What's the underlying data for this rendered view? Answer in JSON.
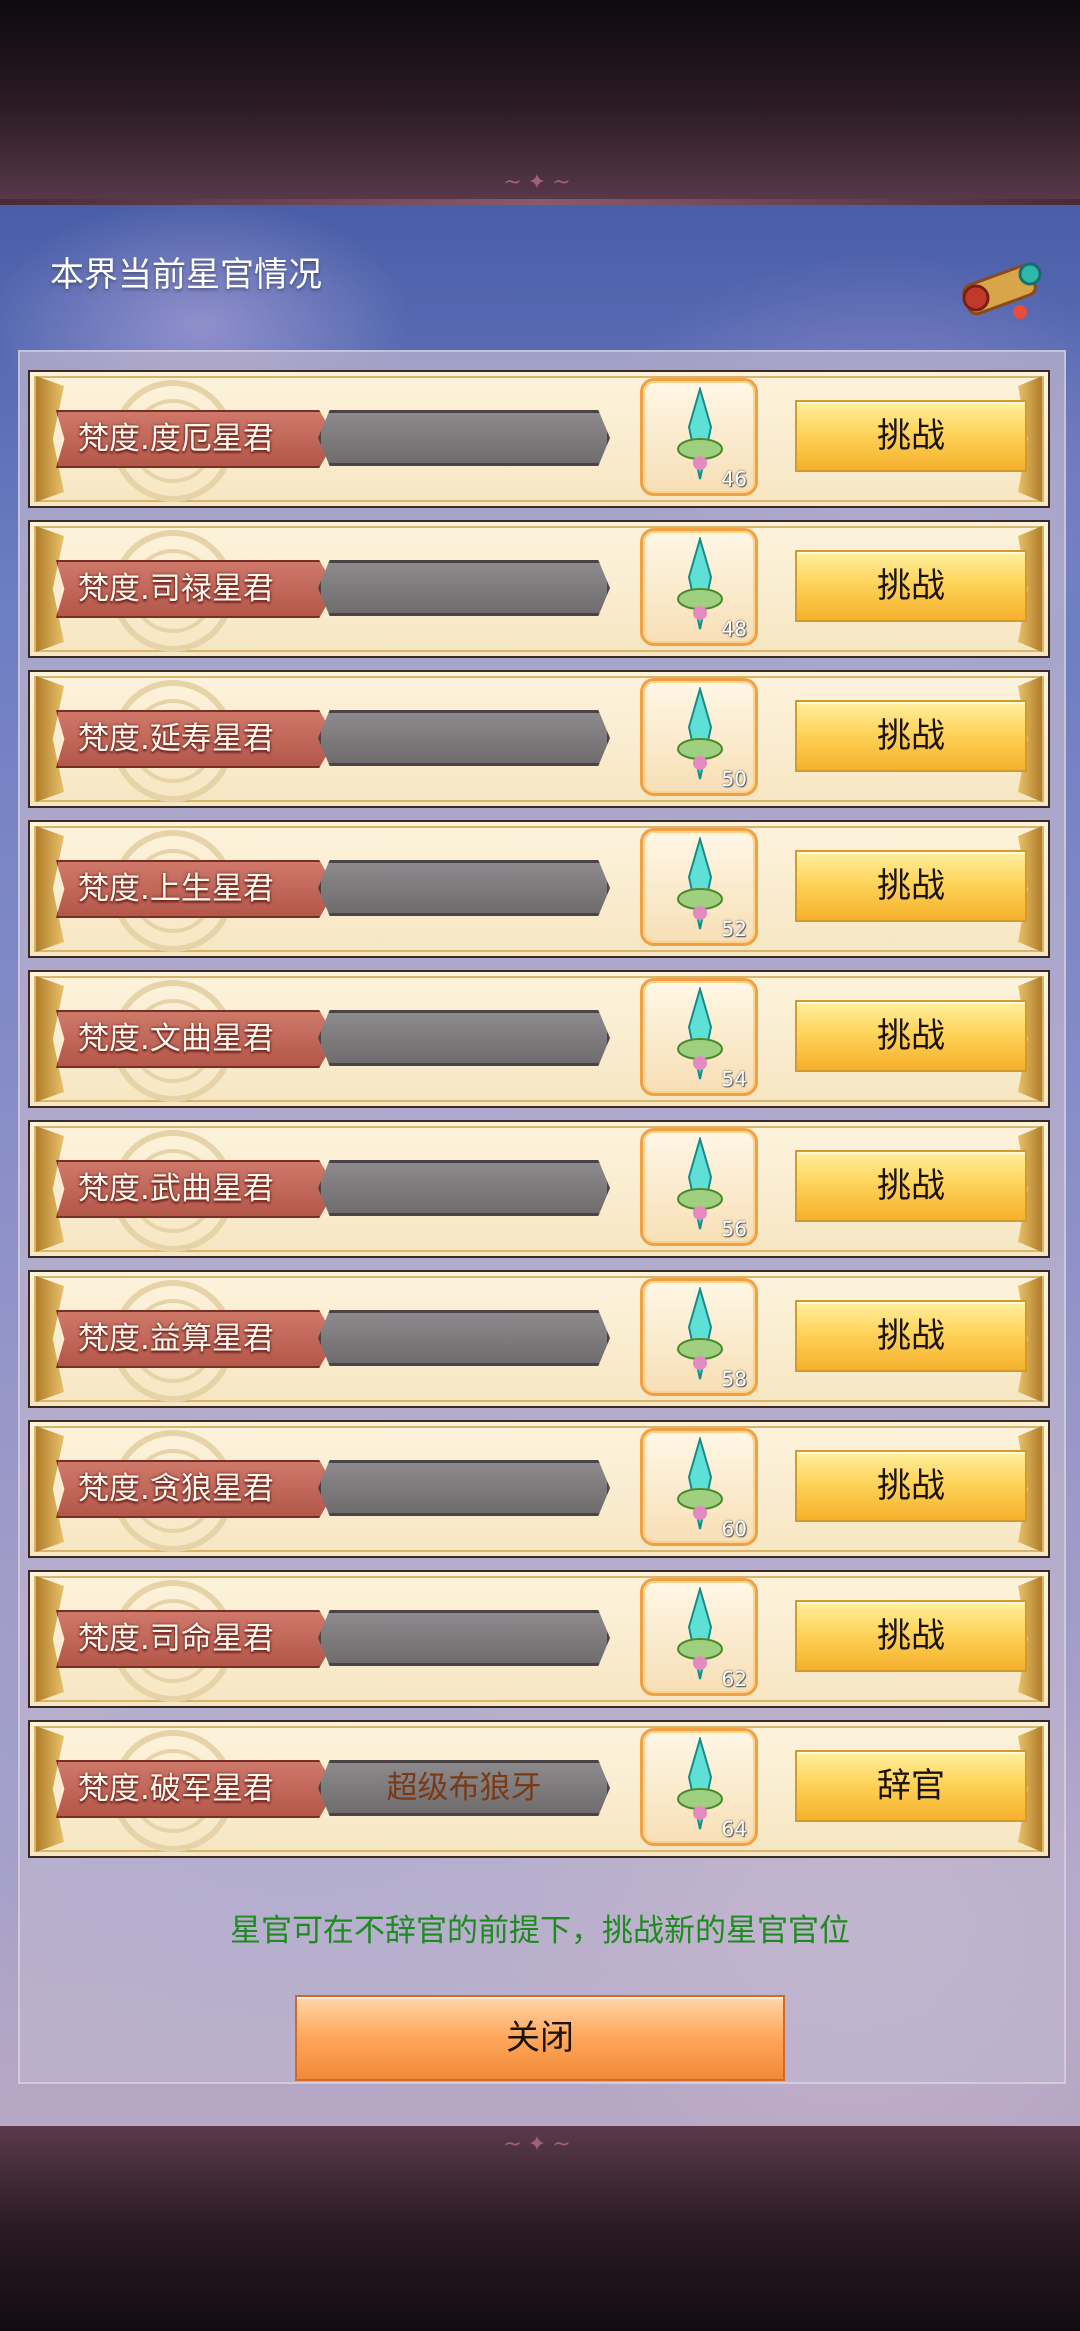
{
  "dialog": {
    "title": "本界当前星官情况",
    "hint": "星官可在不辞官的前提下，挑战新的星官官位",
    "close_label": "关闭"
  },
  "rows": [
    {
      "name": "梵度.度厄星君",
      "holder": "",
      "level": "46",
      "action": "挑战"
    },
    {
      "name": "梵度.司禄星君",
      "holder": "",
      "level": "48",
      "action": "挑战"
    },
    {
      "name": "梵度.延寿星君",
      "holder": "",
      "level": "50",
      "action": "挑战"
    },
    {
      "name": "梵度.上生星君",
      "holder": "",
      "level": "52",
      "action": "挑战"
    },
    {
      "name": "梵度.文曲星君",
      "holder": "",
      "level": "54",
      "action": "挑战"
    },
    {
      "name": "梵度.武曲星君",
      "holder": "",
      "level": "56",
      "action": "挑战"
    },
    {
      "name": "梵度.益算星君",
      "holder": "",
      "level": "58",
      "action": "挑战"
    },
    {
      "name": "梵度.贪狼星君",
      "holder": "",
      "level": "60",
      "action": "挑战"
    },
    {
      "name": "梵度.司命星君",
      "holder": "",
      "level": "62",
      "action": "挑战"
    },
    {
      "name": "梵度.破军星君",
      "holder": "超级布狼牙",
      "level": "64",
      "action": "辞官"
    }
  ],
  "colors": {
    "hint_text": "#1f8a20",
    "challenge_button": "#ffd45a",
    "close_button": "#ffa65a",
    "name_ribbon": "#b25648"
  },
  "icons": {
    "item": "sword-icon",
    "decoration": "scroll-icon",
    "medallion": "medallion-icon"
  }
}
